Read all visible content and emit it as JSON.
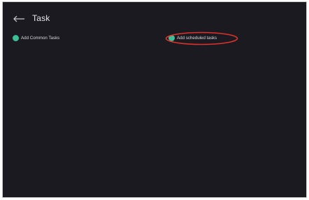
{
  "header": {
    "back_icon": "arrow-left-icon",
    "title": "Task"
  },
  "actions": [
    {
      "label": "Add Common Tasks",
      "icon": "add-circle-icon"
    },
    {
      "label": "Add scheduled tasks",
      "icon": "add-circle-icon"
    }
  ],
  "colors": {
    "background": "#1a1a20",
    "accent": "#3dbf95",
    "highlight": "#e0322c",
    "text": "#e6e6ea"
  }
}
